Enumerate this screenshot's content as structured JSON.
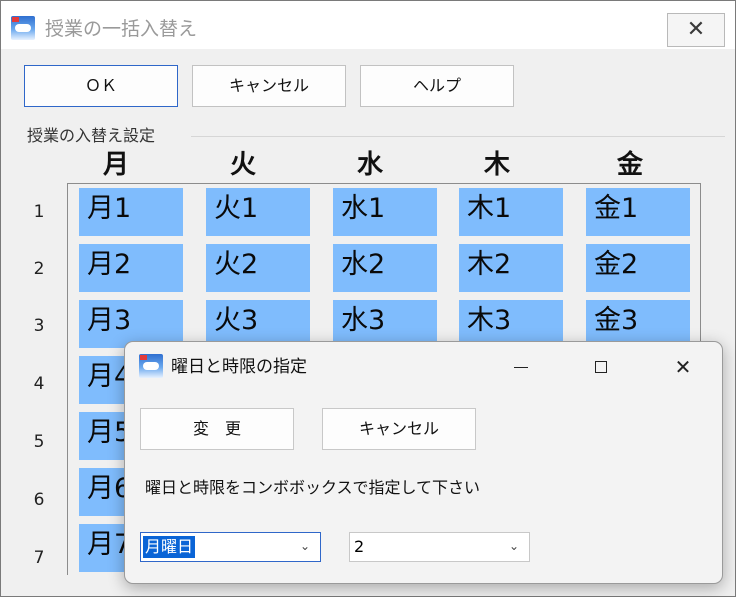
{
  "main_window": {
    "title": "授業の一括入替え",
    "close_glyph": "✕"
  },
  "toolbar": {
    "ok_label": "ＯＫ",
    "cancel_label": "キャンセル",
    "help_label": "ヘルプ"
  },
  "swap_settings": {
    "group_label": "授業の入替え設定",
    "days": [
      "月",
      "火",
      "水",
      "木",
      "金"
    ],
    "periods": [
      "1",
      "2",
      "3",
      "4",
      "5",
      "6",
      "7"
    ],
    "rows": [
      [
        "月1",
        "火1",
        "水1",
        "木1",
        "金1"
      ],
      [
        "月2",
        "火2",
        "水2",
        "木2",
        "金2"
      ],
      [
        "月3",
        "火3",
        "水3",
        "木3",
        "金3"
      ],
      [
        "月4",
        "",
        "",
        "",
        ""
      ],
      [
        "月5",
        "",
        "",
        "",
        ""
      ],
      [
        "月6",
        "",
        "",
        "",
        ""
      ],
      [
        "月7",
        "",
        "",
        "",
        ""
      ]
    ],
    "cell_color": "#7fbcfd"
  },
  "dialog": {
    "title": "曜日と時限の指定",
    "minimize_glyph": "—",
    "maximize_glyph": "☐",
    "close_glyph": "✕",
    "change_label": "変　更",
    "cancel_label": "キャンセル",
    "instruction": "曜日と時限をコンボボックスで指定して下さい",
    "weekday_combo": {
      "value": "月曜日",
      "arrow": "⌄"
    },
    "period_combo": {
      "value": "2",
      "arrow": "⌄"
    }
  },
  "colors": {
    "accent_border": "#2f67c9",
    "selection": "#0a64d6"
  }
}
